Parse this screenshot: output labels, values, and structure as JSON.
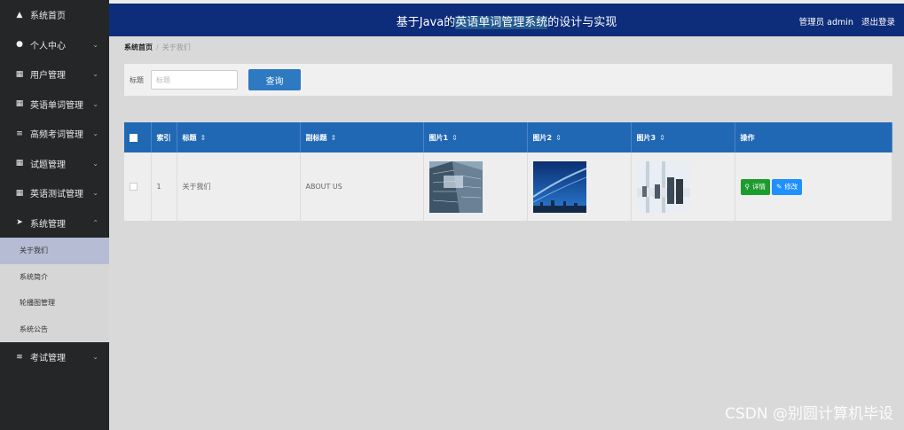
{
  "header": {
    "title_pre": "基于Java的",
    "title_hl": "英语单词管理系统",
    "title_post": "的设计与实现",
    "user_label": "管理员 admin",
    "logout_label": "退出登录"
  },
  "sidebar": {
    "items": [
      {
        "icon": "home-icon",
        "label": "系统首页"
      },
      {
        "icon": "user-icon",
        "label": "个人中心"
      },
      {
        "icon": "grid-icon",
        "label": "用户管理"
      },
      {
        "icon": "grid-icon",
        "label": "英语单词管理"
      },
      {
        "icon": "list-icon",
        "label": "高频考词管理"
      },
      {
        "icon": "grid-icon",
        "label": "试题管理"
      },
      {
        "icon": "grid-icon",
        "label": "英语测试管理"
      },
      {
        "icon": "send-icon",
        "label": "系统管理"
      }
    ],
    "sub_items": [
      {
        "label": "关于我们",
        "active": true
      },
      {
        "label": "系统简介"
      },
      {
        "label": "轮播图管理"
      },
      {
        "label": "系统公告"
      }
    ],
    "last_item": {
      "icon": "sliders-icon",
      "label": "考试管理"
    }
  },
  "breadcrumb": {
    "home": "系统首页",
    "current": "关于我们"
  },
  "search": {
    "label": "标题",
    "placeholder": "标题",
    "button": "查询"
  },
  "table": {
    "headers": [
      "索引",
      "标题",
      "副标题",
      "图片1",
      "图片2",
      "图片3",
      "操作"
    ],
    "rows": [
      {
        "index": "1",
        "title": "关于我们",
        "subtitle": "ABOUT US",
        "detail": "详情",
        "edit": "修改"
      }
    ]
  },
  "watermark": "CSDN @别圆计算机毕设",
  "colors": {
    "topbar": "#0d2c7a",
    "sidebar": "#242628",
    "table_header": "#2168b4",
    "primary_button": "#2d79c2",
    "detail_button": "#1d9b2e",
    "edit_button": "#1e90ff"
  }
}
